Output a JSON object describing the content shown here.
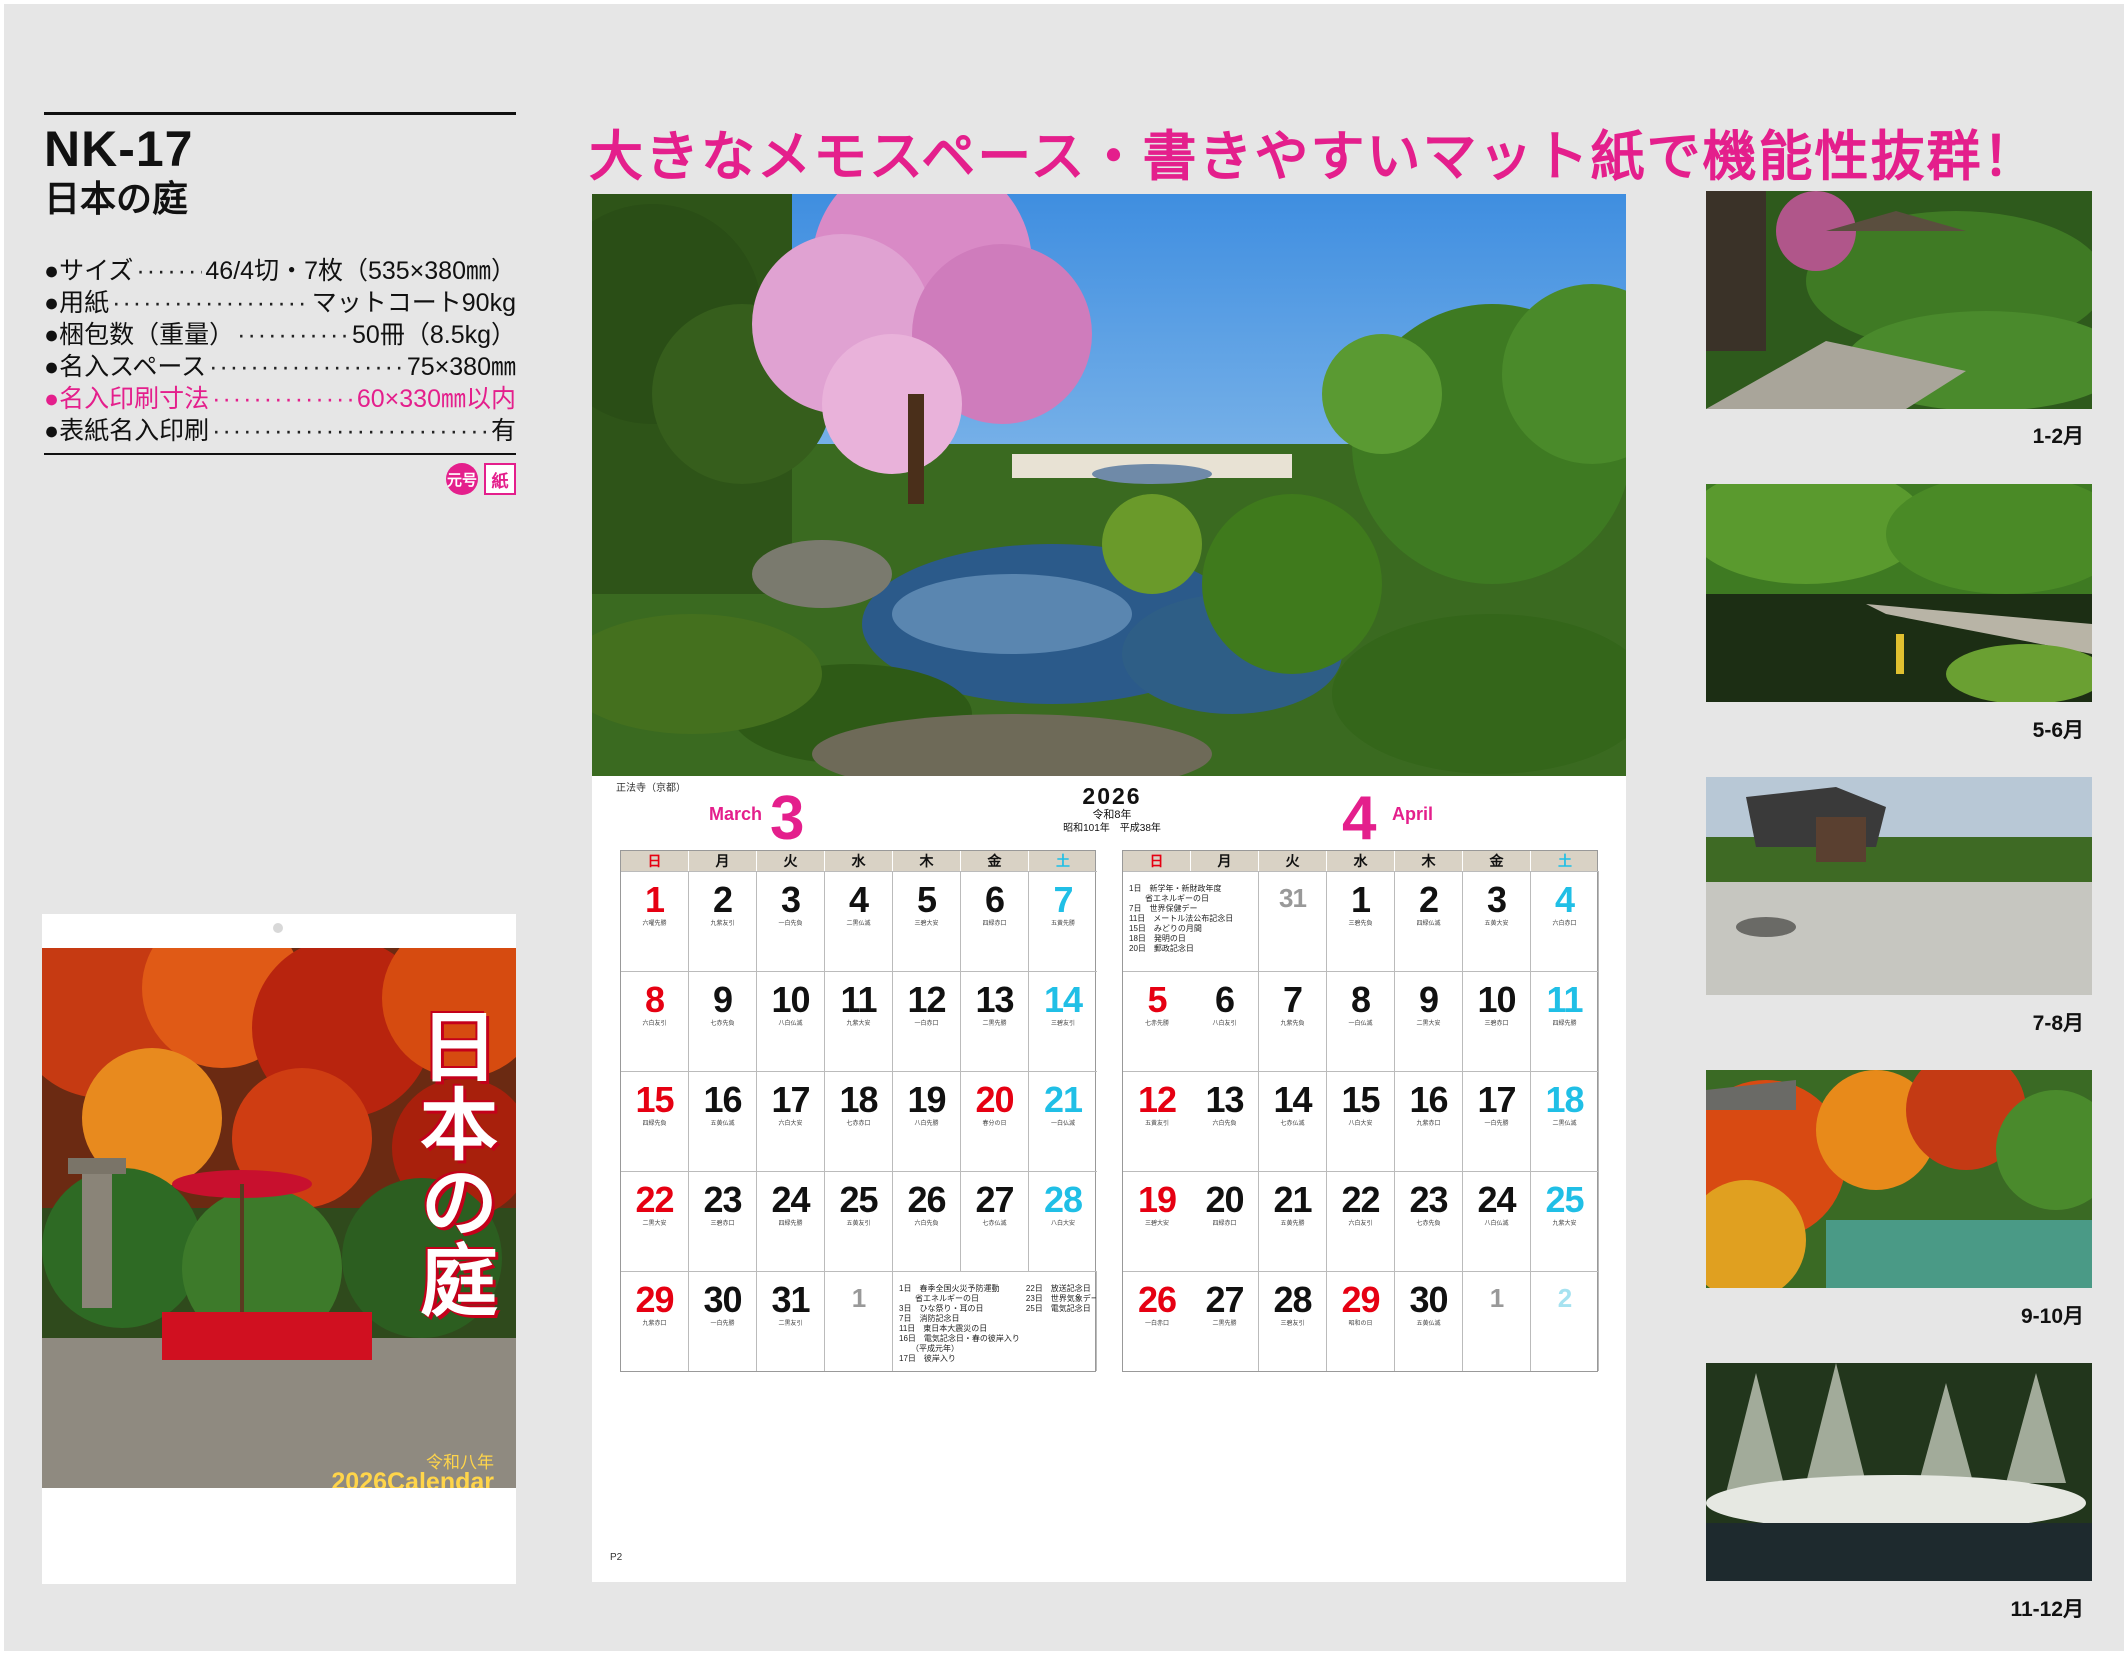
{
  "product": {
    "model": "NK-17",
    "title": "日本の庭",
    "specs": [
      {
        "label": "サイズ",
        "value": "46/4切・7枚（535×380㎜）"
      },
      {
        "label": "用紙",
        "value": "マットコート90kg"
      },
      {
        "label": "梱包数（重量）",
        "value": "50冊（8.5kg）"
      },
      {
        "label": "名入スペース",
        "value": "75×380㎜"
      },
      {
        "label": "名入印刷寸法",
        "value": "60×330㎜以内"
      },
      {
        "label": "表紙名入印刷",
        "value": "有"
      }
    ],
    "bullet": "●",
    "badges": [
      "元号",
      "紙"
    ],
    "accent_color": "#e41f8c"
  },
  "cover": {
    "title_vertical": "日本の庭",
    "era": "令和八年",
    "calendar_label": "2026Calendar"
  },
  "headline": "大きなメモスペース・書きやすいマット紙で機能性抜群！",
  "main": {
    "photo_caption": "正法寺（京都）",
    "page_number": "P2",
    "year": "2026",
    "era_line1": "令和8年",
    "era_line2": "昭和101年　平成38年",
    "weekdays": [
      "日",
      "月",
      "火",
      "水",
      "木",
      "金",
      "土"
    ],
    "march": {
      "month_number": "3",
      "month_name": "March",
      "days": [
        {
          "n": "1",
          "c": "red",
          "s": "六曜先勝"
        },
        {
          "n": "2",
          "c": "",
          "s": "九紫友引"
        },
        {
          "n": "3",
          "c": "",
          "s": "一白先負"
        },
        {
          "n": "4",
          "c": "",
          "s": "二黒仏滅"
        },
        {
          "n": "5",
          "c": "",
          "s": "三碧大安"
        },
        {
          "n": "6",
          "c": "",
          "s": "四緑赤口"
        },
        {
          "n": "7",
          "c": "cyan",
          "s": "五黄先勝"
        },
        {
          "n": "8",
          "c": "red",
          "s": "六白友引"
        },
        {
          "n": "9",
          "c": "",
          "s": "七赤先負"
        },
        {
          "n": "10",
          "c": "",
          "s": "八白仏滅"
        },
        {
          "n": "11",
          "c": "",
          "s": "九紫大安"
        },
        {
          "n": "12",
          "c": "",
          "s": "一白赤口"
        },
        {
          "n": "13",
          "c": "",
          "s": "二黒先勝"
        },
        {
          "n": "14",
          "c": "cyan",
          "s": "三碧友引"
        },
        {
          "n": "15",
          "c": "red",
          "s": "四緑先負"
        },
        {
          "n": "16",
          "c": "",
          "s": "五黄仏滅"
        },
        {
          "n": "17",
          "c": "",
          "s": "六白大安"
        },
        {
          "n": "18",
          "c": "",
          "s": "七赤赤口"
        },
        {
          "n": "19",
          "c": "",
          "s": "八白先勝"
        },
        {
          "n": "20",
          "c": "red",
          "s": "春分の日"
        },
        {
          "n": "21",
          "c": "cyan",
          "s": "一白仏滅"
        },
        {
          "n": "22",
          "c": "red",
          "s": "二黒大安"
        },
        {
          "n": "23",
          "c": "",
          "s": "三碧赤口"
        },
        {
          "n": "24",
          "c": "",
          "s": "四緑先勝"
        },
        {
          "n": "25",
          "c": "",
          "s": "五黄友引"
        },
        {
          "n": "26",
          "c": "",
          "s": "六白先負"
        },
        {
          "n": "27",
          "c": "",
          "s": "七赤仏滅"
        },
        {
          "n": "28",
          "c": "cyan",
          "s": "八白大安"
        },
        {
          "n": "29",
          "c": "red",
          "s": "九紫赤口"
        },
        {
          "n": "30",
          "c": "",
          "s": "一白先勝"
        },
        {
          "n": "31",
          "c": "",
          "s": "二黒友引"
        },
        {
          "n": "1",
          "c": "dim",
          "s": ""
        }
      ],
      "notes_left": "1日　春季全国火災予防運動\n　　省エネルギーの日\n3日　ひな祭り・耳の日\n7日　消防記念日\n11日　東日本大震災の日\n16日　電気記念日・春の彼岸入り\n　　（平成元年）\n17日　彼岸入り",
      "notes_right": "22日　放送記念日\n23日　世界気象デー\n25日　電気記念日\n　　"
    },
    "april": {
      "month_number": "4",
      "month_name": "April",
      "notes": "1日　新学年・新財政年度\n　　省エネルギーの日\n7日　世界保健デー\n11日　メートル法公布記念日\n15日　みどりの月間\n18日　発明の日\n20日　郵政記念日",
      "days": [
        {
          "n": "31",
          "c": "dim",
          "s": ""
        },
        {
          "n": "1",
          "c": "",
          "s": "三碧先負"
        },
        {
          "n": "2",
          "c": "",
          "s": "四緑仏滅"
        },
        {
          "n": "3",
          "c": "",
          "s": "五黄大安"
        },
        {
          "n": "4",
          "c": "cyan",
          "s": "六白赤口"
        },
        {
          "n": "5",
          "c": "red",
          "s": "七赤先勝"
        },
        {
          "n": "6",
          "c": "",
          "s": "八白友引"
        },
        {
          "n": "7",
          "c": "",
          "s": "九紫先負"
        },
        {
          "n": "8",
          "c": "",
          "s": "一白仏滅"
        },
        {
          "n": "9",
          "c": "",
          "s": "二黒大安"
        },
        {
          "n": "10",
          "c": "",
          "s": "三碧赤口"
        },
        {
          "n": "11",
          "c": "cyan",
          "s": "四緑先勝"
        },
        {
          "n": "12",
          "c": "red",
          "s": "五黄友引"
        },
        {
          "n": "13",
          "c": "",
          "s": "六白先負"
        },
        {
          "n": "14",
          "c": "",
          "s": "七赤仏滅"
        },
        {
          "n": "15",
          "c": "",
          "s": "八白大安"
        },
        {
          "n": "16",
          "c": "",
          "s": "九紫赤口"
        },
        {
          "n": "17",
          "c": "",
          "s": "一白先勝"
        },
        {
          "n": "18",
          "c": "cyan",
          "s": "二黒仏滅"
        },
        {
          "n": "19",
          "c": "red",
          "s": "三碧大安"
        },
        {
          "n": "20",
          "c": "",
          "s": "四緑赤口"
        },
        {
          "n": "21",
          "c": "",
          "s": "五黄先勝"
        },
        {
          "n": "22",
          "c": "",
          "s": "六白友引"
        },
        {
          "n": "23",
          "c": "",
          "s": "七赤先負"
        },
        {
          "n": "24",
          "c": "",
          "s": "八白仏滅"
        },
        {
          "n": "25",
          "c": "cyan",
          "s": "九紫大安"
        },
        {
          "n": "26",
          "c": "red",
          "s": "一白赤口"
        },
        {
          "n": "27",
          "c": "",
          "s": "二黒先勝"
        },
        {
          "n": "28",
          "c": "",
          "s": "三碧友引"
        },
        {
          "n": "29",
          "c": "red",
          "s": "昭和の日"
        },
        {
          "n": "30",
          "c": "",
          "s": "五黄仏滅"
        },
        {
          "n": "1",
          "c": "dim",
          "s": ""
        },
        {
          "n": "2",
          "c": "dimcyan",
          "s": ""
        }
      ]
    }
  },
  "thumbnails": [
    {
      "label": "1-2月"
    },
    {
      "label": "5-6月"
    },
    {
      "label": "7-8月"
    },
    {
      "label": "9-10月"
    },
    {
      "label": "11-12月"
    }
  ]
}
